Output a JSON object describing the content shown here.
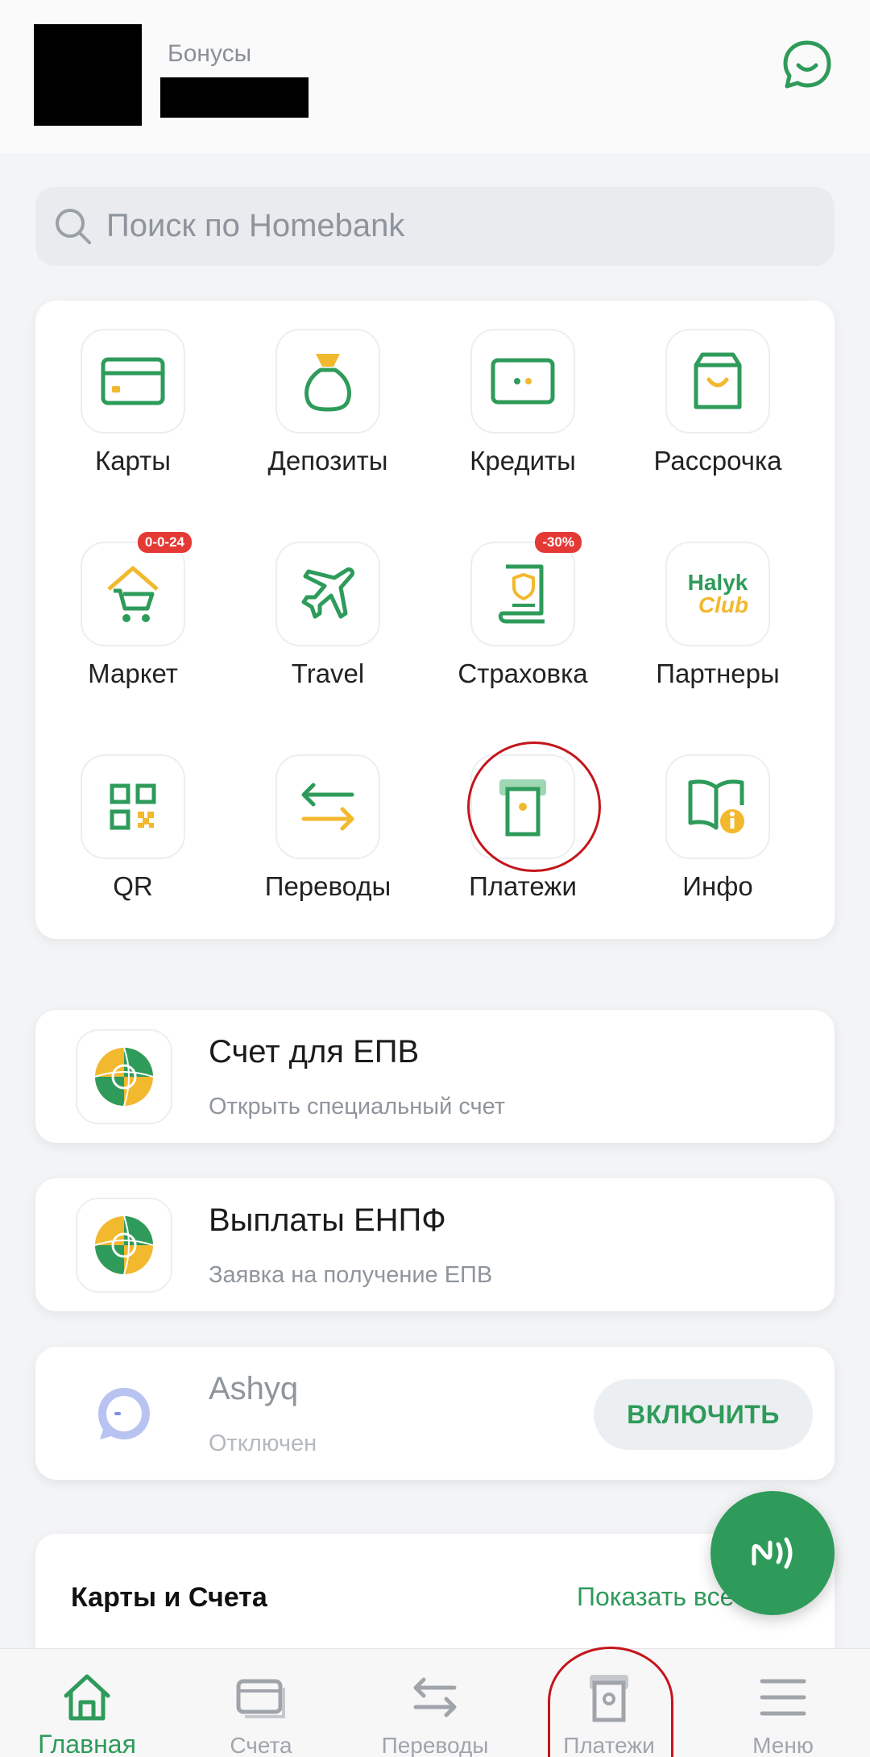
{
  "header": {
    "bonus_label": "Бонусы"
  },
  "search": {
    "placeholder": "Поиск по Homebank"
  },
  "grid": {
    "items": [
      {
        "label": "Карты",
        "icon": "card-icon"
      },
      {
        "label": "Депозиты",
        "icon": "money-bag-icon"
      },
      {
        "label": "Кредиты",
        "icon": "credit-icon"
      },
      {
        "label": "Рассрочка",
        "icon": "shopping-bag-icon"
      },
      {
        "label": "Маркет",
        "icon": "market-cart-icon",
        "badge": "0-0-24"
      },
      {
        "label": "Travel",
        "icon": "airplane-icon"
      },
      {
        "label": "Страховка",
        "icon": "insurance-icon",
        "badge": "-30%"
      },
      {
        "label": "Партнеры",
        "icon": "halyk-club-icon",
        "logo_text_1": "Halyk",
        "logo_text_2": "Club"
      },
      {
        "label": "QR",
        "icon": "qr-icon"
      },
      {
        "label": "Переводы",
        "icon": "transfer-arrows-icon"
      },
      {
        "label": "Платежи",
        "icon": "payment-terminal-icon"
      },
      {
        "label": "Инфо",
        "icon": "info-book-icon"
      }
    ]
  },
  "cards": [
    {
      "title": "Счет для ЕПВ",
      "subtitle": "Открыть специальный счет",
      "icon": "enpf-logo-icon"
    },
    {
      "title": "Выплаты ЕНПФ",
      "subtitle": "Заявка на получение ЕПВ",
      "icon": "enpf-logo-icon"
    },
    {
      "title": "Ashyq",
      "subtitle": "Отключен",
      "icon": "ashyq-logo-icon",
      "button": "ВКЛЮЧИТЬ"
    }
  ],
  "accounts": {
    "title": "Карты и Счета",
    "link": "Показать все"
  },
  "bottom_nav": [
    {
      "label": "Главная",
      "icon": "home-icon",
      "active": true
    },
    {
      "label": "Счета",
      "icon": "accounts-icon"
    },
    {
      "label": "Переводы",
      "icon": "transfers-icon"
    },
    {
      "label": "Платежи",
      "icon": "payments-icon"
    },
    {
      "label": "Меню",
      "icon": "menu-icon"
    }
  ],
  "colors": {
    "brand_green": "#2e9b5a",
    "accent_yellow": "#f2b82e",
    "badge_red": "#e53935",
    "highlight_ring": "#c4151c"
  }
}
